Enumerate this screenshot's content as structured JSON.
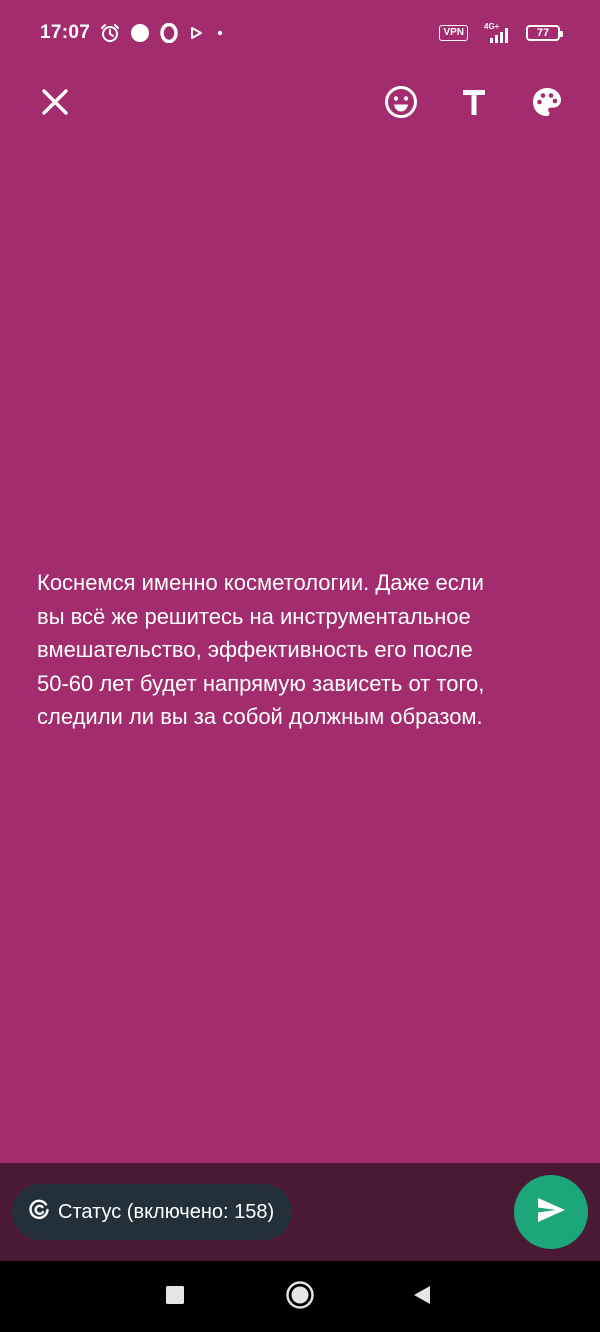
{
  "status_bar": {
    "time": "17:07",
    "vpn_label": "VPN",
    "network_label": "4G+",
    "battery_level": "77",
    "icons": [
      "alarm-icon",
      "circle-notification-icon",
      "opera-icon",
      "play-icon",
      "dot-icon",
      "vpn-icon",
      "signal-icon",
      "battery-icon"
    ]
  },
  "toolbar": {
    "icons": [
      "close-icon",
      "emoji-icon",
      "text-icon",
      "palette-icon"
    ]
  },
  "content": {
    "status_text": "Коснемся именно косметологии. Даже если\nвы всё же решитесь на инструментальное\nвмешательство, эффективность его после\n50-60 лет будет напрямую зависеть от того,\nследили ли вы за собой должным образом."
  },
  "bottom": {
    "audience_label": "Статус (включено: 158)",
    "send_icon": "send-icon"
  },
  "nav": {
    "icons": [
      "recents-icon",
      "home-icon",
      "back-icon"
    ]
  },
  "colors": {
    "background": "#a22c6d",
    "bottom_panel": "#4a1a34",
    "chip": "#23303a",
    "send": "#1da67a"
  }
}
